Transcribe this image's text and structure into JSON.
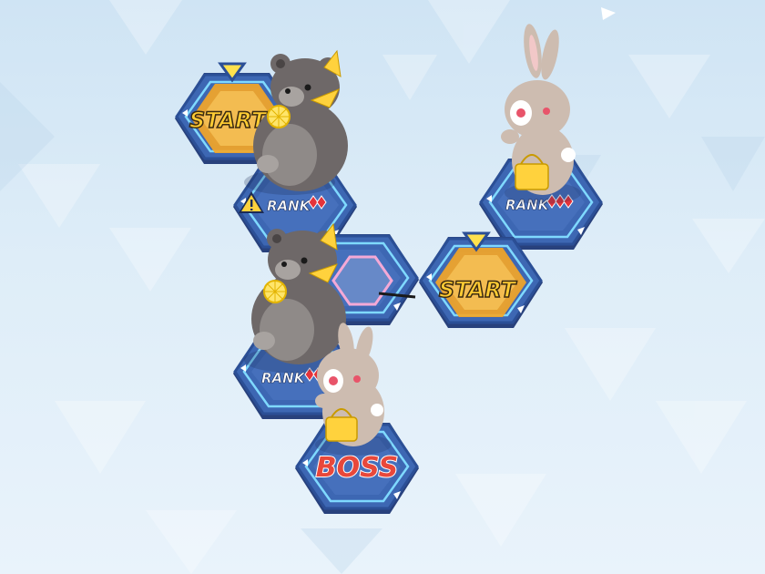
{
  "labels": {
    "start": "START",
    "rank": "RANK",
    "boss": "BOSS"
  },
  "icons": {
    "start_marker": "triangle-marker-icon",
    "warning": "warning-icon",
    "rank_pip": "red-diamond-icon",
    "corner_arrow": "white-triangle-icon"
  },
  "characters": {
    "bear": "bear-plush",
    "bunny": "bunny-plush"
  },
  "colors": {
    "tile_blue": "#3d67b3",
    "tile_rim": "#2b4f96",
    "tile_highlight": "#7fd9ff",
    "start_orange": "#f6a623",
    "start_text": "#ffcc33",
    "boss_red": "#e8483b",
    "rank_red": "#e5333a",
    "selector_pink": "#f4a9d6",
    "background": "#d8e9f6"
  }
}
